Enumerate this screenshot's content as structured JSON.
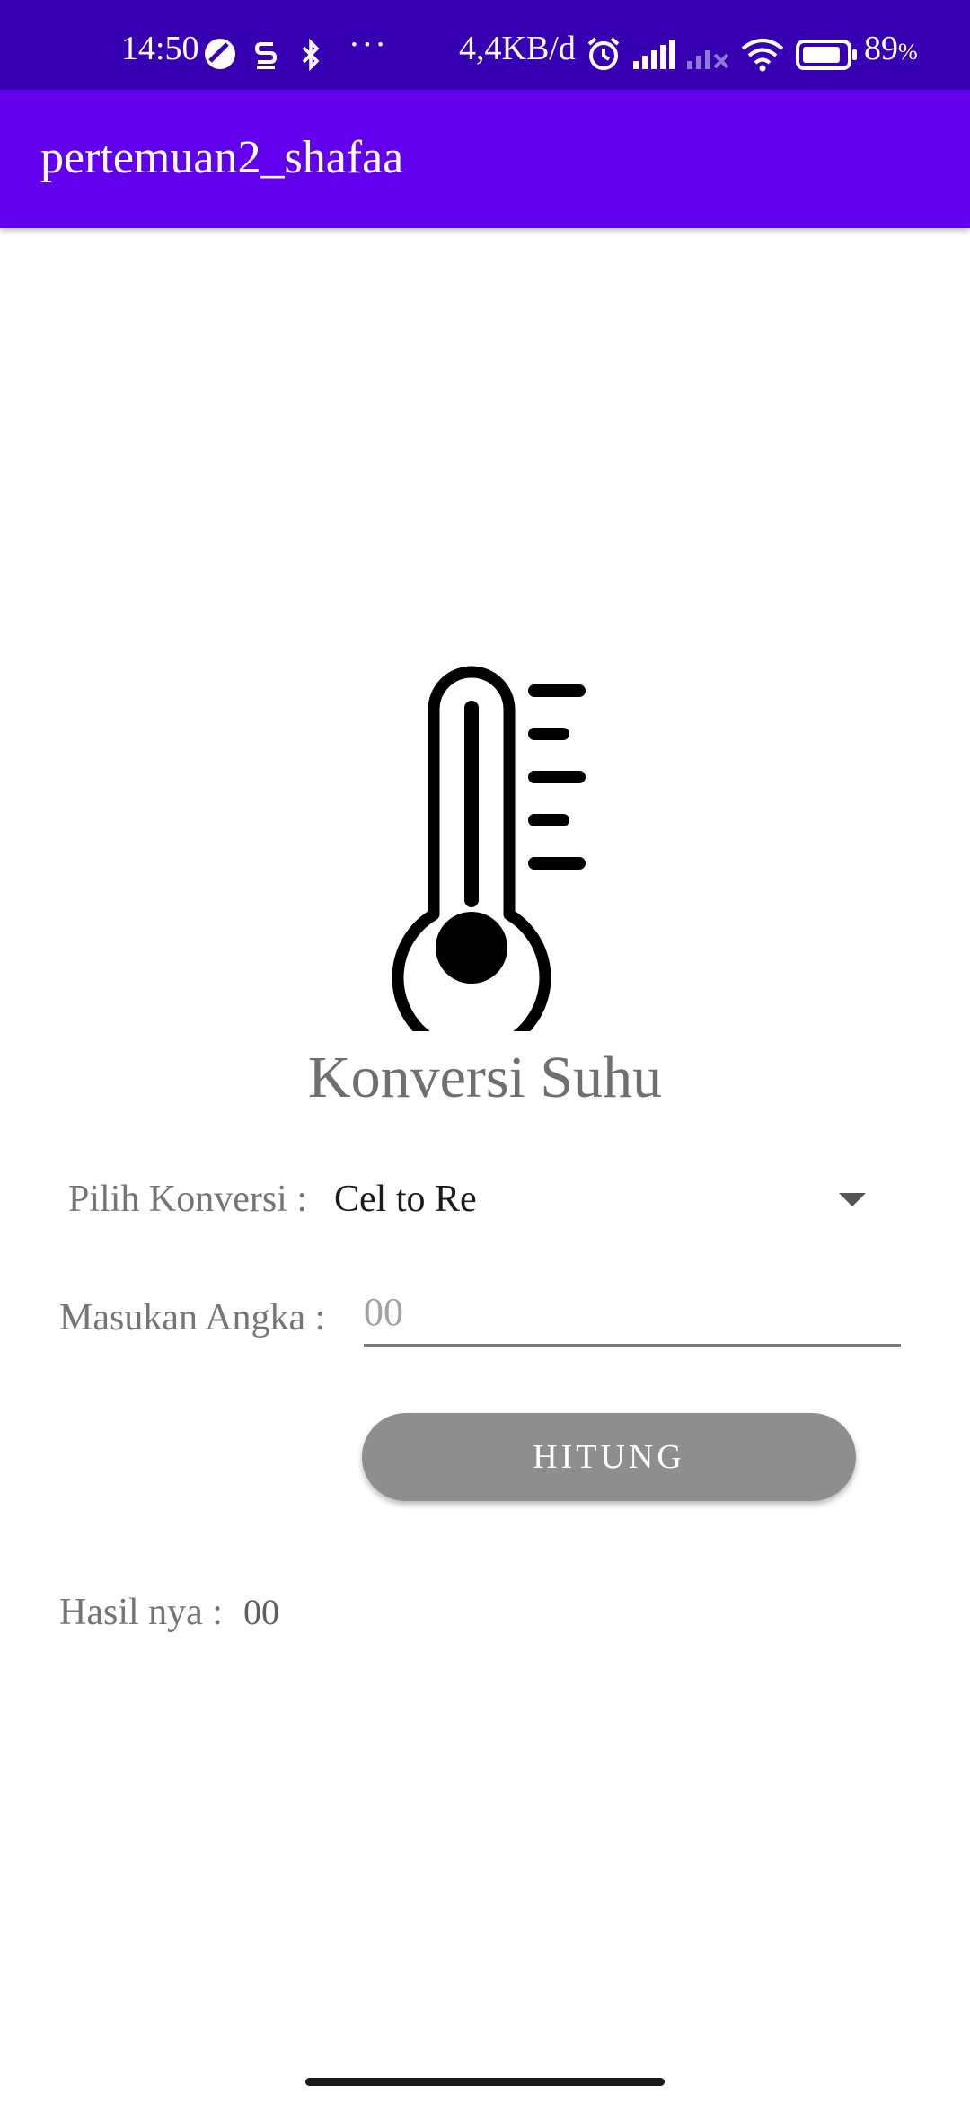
{
  "status_bar": {
    "time": "14:50",
    "network_speed": "4,4KB/d",
    "battery_percent": "89",
    "battery_unit": "%",
    "more_dots": "···",
    "icons": [
      "data-saver-icon",
      "s-notification-icon",
      "bluetooth-icon",
      "alarm-icon",
      "signal-icon",
      "signal-no-service-icon",
      "wifi-icon",
      "battery-icon"
    ],
    "battery_level": 0.89
  },
  "app_bar": {
    "title": "pertemuan2_shafaa"
  },
  "main": {
    "title": "Konversi Suhu",
    "icon": "thermometer-icon",
    "conversion_label": "Pilih Konversi :",
    "conversion_selected": "Cel to Re",
    "input_label": "Masukan Angka :",
    "input_placeholder": "00",
    "input_value": "",
    "button_label": "HITUNG",
    "result_label": "Hasil nya :",
    "result_value": "00"
  },
  "colors": {
    "status_bar": "#3700b3",
    "app_bar": "#6200ee",
    "button": "#8e8e8e",
    "text_gray": "#757575"
  }
}
